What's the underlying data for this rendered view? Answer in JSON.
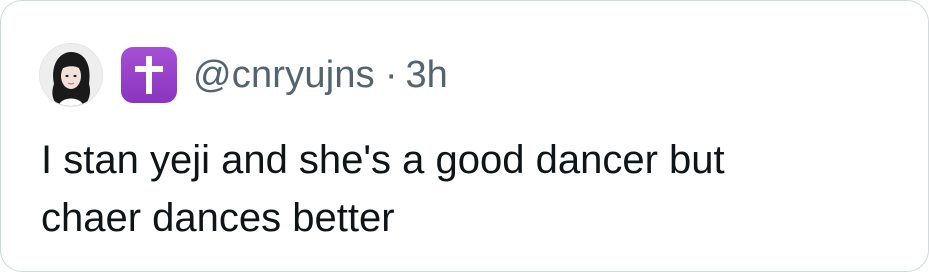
{
  "tweet": {
    "handle": "@cnryujns",
    "separator": "·",
    "time": "3h",
    "badge_icon": "latin-cross-emoji",
    "text_line1": "I stan yeji and she's a good dancer but",
    "text_line2": "chaer dances better"
  },
  "colors": {
    "text": "#0f1419",
    "secondary_text": "#536471",
    "border": "#cfd9de",
    "badge_purple": "#9a44cc"
  }
}
